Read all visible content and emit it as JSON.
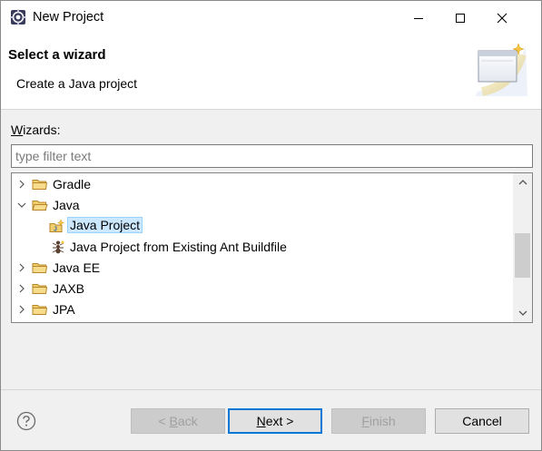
{
  "window": {
    "title": "New Project"
  },
  "banner": {
    "title": "Select a wizard",
    "description": "Create a Java project"
  },
  "wizards": {
    "label_underlined": "W",
    "label_rest": "izards:",
    "filter_placeholder": "type filter text",
    "filter_value": ""
  },
  "tree": {
    "items": [
      {
        "label": "Gradle",
        "expanded": false,
        "icon": "folder-icon"
      },
      {
        "label": "Java",
        "expanded": true,
        "icon": "folder-icon"
      },
      {
        "label": "Java Project",
        "icon": "java-project-icon",
        "selected": true
      },
      {
        "label": "Java Project from Existing Ant Buildfile",
        "icon": "ant-icon"
      },
      {
        "label": "Java EE",
        "expanded": false,
        "icon": "folder-icon"
      },
      {
        "label": "JAXB",
        "expanded": false,
        "icon": "folder-icon"
      },
      {
        "label": "JPA",
        "expanded": false,
        "icon": "folder-icon"
      }
    ]
  },
  "footer": {
    "back_underlined": "B",
    "back_prefix": "< ",
    "back_rest": "ack",
    "next_underlined": "N",
    "next_rest": "ext >",
    "finish_underlined": "F",
    "finish_rest": "inish",
    "cancel_label": "Cancel"
  },
  "colors": {
    "selection": "#cce8ff",
    "default_button_border": "#0078d7",
    "folder": "#e8b84a"
  }
}
